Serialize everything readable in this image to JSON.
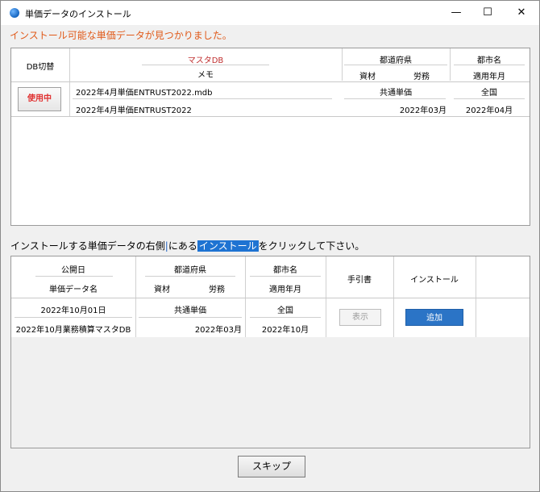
{
  "window": {
    "title": "単価データのインストール",
    "controls": {
      "minimize": "—",
      "maximize": "☐",
      "close": "✕"
    }
  },
  "headline": "インストール可能な単価データが見つかりました。",
  "installed_table": {
    "headers": {
      "db_switch": "DB切替",
      "master_db": "マスタDB",
      "memo": "メモ",
      "prefecture": "都道府県",
      "material": "資材",
      "labor": "労務",
      "city": "都市名",
      "apply_month": "適用年月"
    },
    "row": {
      "status_button": "使用中",
      "master_db": "2022年4月単価ENTRUST2022.mdb",
      "memo": "2022年4月単価ENTRUST2022",
      "prefecture": "共通単価",
      "labor_month": "2022年03月",
      "city": "全国",
      "apply_month": "2022年04月"
    }
  },
  "instruction": {
    "before": "インストールする単価データの右側",
    "middle": "にある",
    "highlight": "インストール",
    "after": "をクリックして下さい。"
  },
  "available_table": {
    "headers": {
      "release_date": "公開日",
      "price_data_name": "単価データ名",
      "prefecture": "都道府県",
      "material": "資材",
      "labor": "労務",
      "city": "都市名",
      "apply_month": "適用年月",
      "manual": "手引書",
      "install": "インストール"
    },
    "row": {
      "release_date": "2022年10月01日",
      "price_data_name": "2022年10月業務積算マスタDB",
      "prefecture": "共通単価",
      "labor_month": "2022年03月",
      "city": "全国",
      "apply_month": "2022年10月",
      "show_button": "表示",
      "add_button": "追加"
    }
  },
  "skip_button": "スキップ",
  "colors": {
    "headline": "#e05a1a",
    "status": "#e03030",
    "accent": "#2b74c6"
  }
}
